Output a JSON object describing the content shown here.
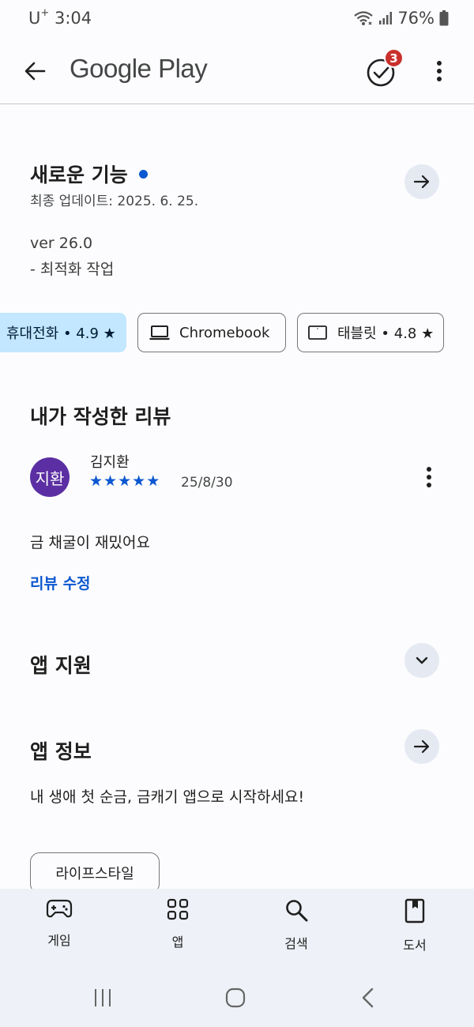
{
  "status": {
    "carrier": "U",
    "carrier_sup": "+",
    "time": "3:04",
    "battery": "76%"
  },
  "appbar": {
    "title": "Google Play",
    "tasks_badge": "3"
  },
  "whats_new": {
    "title": "새로운 기능",
    "updated": "최종 업데이트: 2025. 6. 25.",
    "notes": [
      "ver 26.0",
      "- 최적화 작업"
    ]
  },
  "device_chips": {
    "phone": "휴대전화 • 4.9 ★",
    "chromebook": "Chromebook",
    "tablet": "태블릿 • 4.8 ★"
  },
  "my_review": {
    "title": "내가 작성한 리뷰",
    "avatar_text": "지환",
    "reviewer": "김지환",
    "rating": 5,
    "date": "25/8/30",
    "text": "금 채굴이 재밌어요",
    "edit_label": "리뷰 수정"
  },
  "app_support": {
    "title": "앱 지원"
  },
  "app_info": {
    "title": "앱 정보",
    "description": "내 생애 첫 순금, 금캐기 앱으로 시작하세요!",
    "category": "라이프스타일"
  },
  "bottom_nav": {
    "games": "게임",
    "apps": "앱",
    "search": "검색",
    "books": "도서"
  },
  "colors": {
    "accent": "#0b57d0",
    "chip_selected": "#c2e7ff",
    "badge": "#c9302c",
    "avatar": "#5b2fa3"
  }
}
